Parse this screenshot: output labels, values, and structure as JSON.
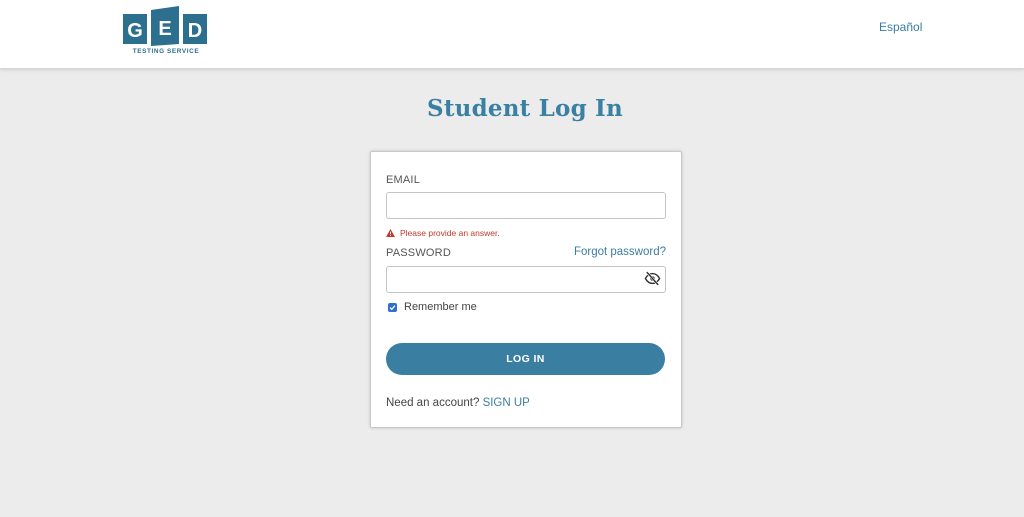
{
  "brand": {
    "logo_letters": [
      "G",
      "E",
      "D"
    ],
    "logo_tagline": "TESTING SERVICE",
    "colors": {
      "primary": "#3a7ea1",
      "logo_dark": "#2c6f8f",
      "error": "#c0392b",
      "checkbox": "#2f6fcf"
    }
  },
  "header": {
    "language_link": "Español"
  },
  "page": {
    "title": "Student Log In"
  },
  "form": {
    "email_label": "EMAIL",
    "email_value": "",
    "email_error": "Please provide an answer.",
    "password_label": "PASSWORD",
    "password_value": "",
    "forgot_link": "Forgot password?",
    "show_password_icon": "eye-slash-icon",
    "remember_label": "Remember me",
    "remember_checked": true,
    "login_button": "LOG IN",
    "signup_prompt": "Need an account?",
    "signup_link": "SIGN UP"
  }
}
